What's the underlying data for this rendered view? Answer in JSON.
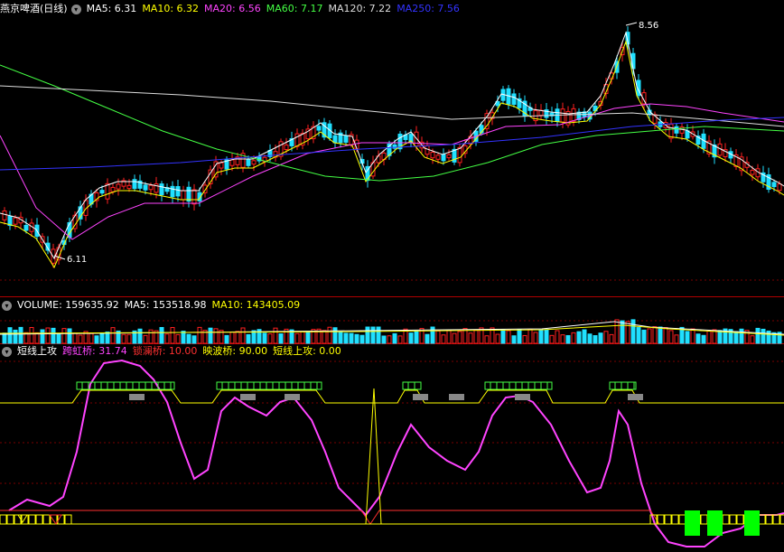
{
  "main": {
    "title": "燕京啤酒(日线)",
    "ma5": "MA5: 6.31",
    "ma10": "MA10: 6.32",
    "ma20": "MA20: 6.56",
    "ma60": "MA60: 7.17",
    "ma120": "MA120: 7.22",
    "ma250": "MA250: 7.56",
    "high_label": "8.56",
    "low_label": "6.11",
    "colors": {
      "ma5": "#ffffff",
      "ma10": "#ffff00",
      "ma20": "#ff44ff",
      "ma60": "#44ff44",
      "ma120": "#dddddd",
      "ma250": "#3333ff"
    }
  },
  "volume": {
    "label": "VOLUME: 159635.92",
    "ma5": "MA5: 153518.98",
    "ma10": "MA10: 143405.09"
  },
  "indicator": {
    "name": "短线上攻",
    "kuahong": "跨虹桥: 31.74",
    "suolan": "锁澜桥: 10.00",
    "yingbo": "映波桥: 90.00",
    "duanxian": "短线上攻: 0.00",
    "colors": {
      "kuahong": "#ff44ff",
      "suolan": "#ff3030",
      "yingbo": "#ffff00",
      "duanxian": "#ffff00"
    }
  },
  "icons": [
    "collapse-circle-icon"
  ]
}
